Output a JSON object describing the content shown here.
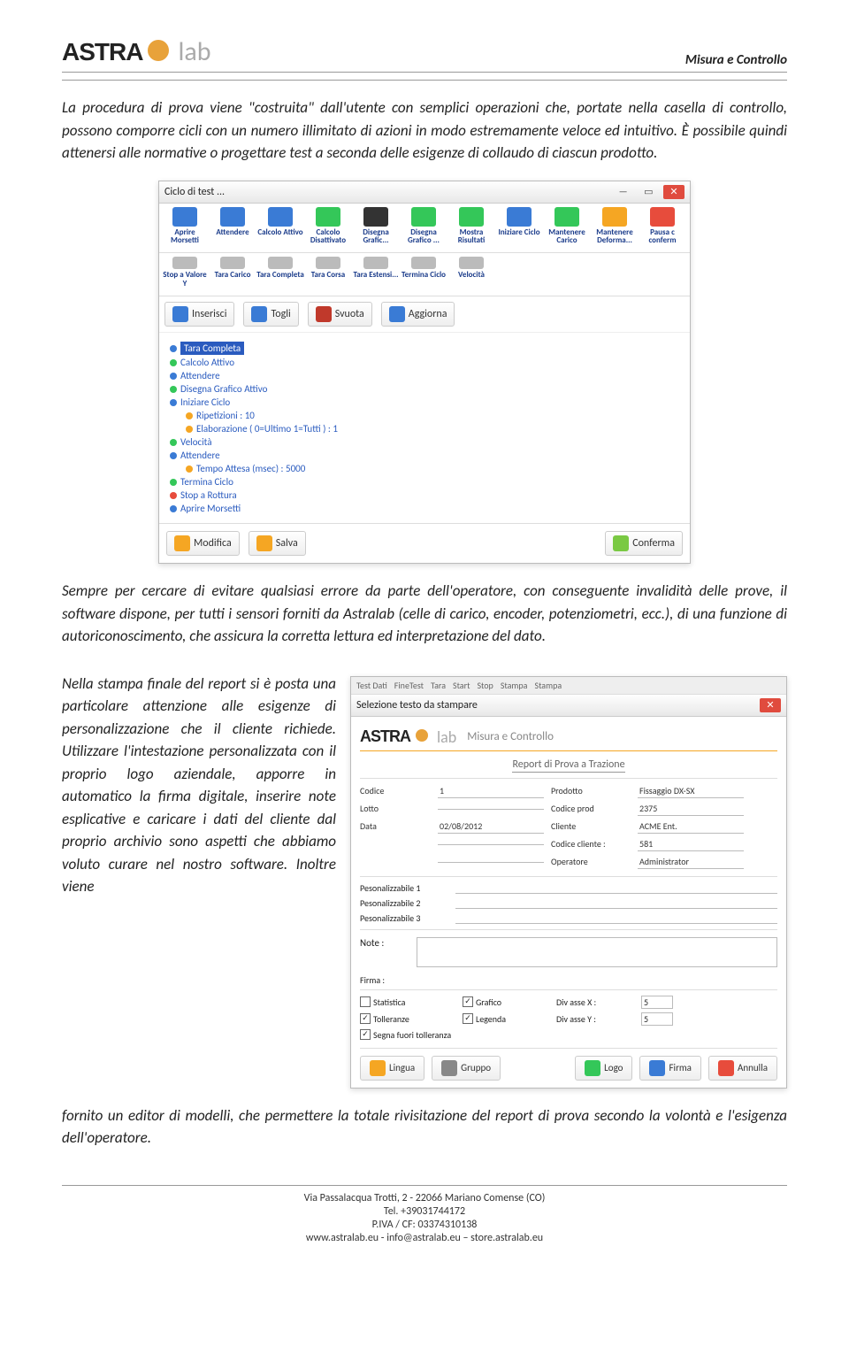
{
  "header": {
    "logo_main": "ASTRA",
    "logo_lab": "lab",
    "right_text": "Misura e Controllo"
  },
  "paragraphs": {
    "p1": "La procedura di prova viene \"costruita\" dall'utente con semplici operazioni che, portate nella casella di controllo, possono comporre cicli con un numero illimitato di azioni in modo estremamente veloce ed intuitivo. È possibile quindi attenersi alle normative o progettare test a seconda delle esigenze di collaudo di ciascun prodotto.",
    "p2": "Sempre per cercare di evitare qualsiasi errore da parte dell'operatore, con conseguente invalidità delle prove, il software dispone, per tutti i sensori forniti da Astralab (celle di carico, encoder, potenziometri, ecc.), di una funzione di autoriconoscimento, che assicura la corretta lettura ed interpretazione del dato.",
    "p3a": "Nella stampa finale del report si è posta una particolare attenzione alle esigenze di personalizzazione che il cliente richiede. Utilizzare l'intestazione personalizzata con il proprio logo aziendale, apporre in automatico la firma digitale, inserire note esplicative e caricare i dati del cliente dal proprio archivio sono aspetti che abbiamo voluto curare nel nostro software. Inoltre viene",
    "p3b": "fornito un editor di modelli, che permettere la totale rivisitazione del report di prova secondo la volontà e l'esigenza dell'operatore."
  },
  "ss1": {
    "title": "Ciclo di test ...",
    "toolbar": [
      {
        "label": "Aprire Morsetti",
        "c": "ic-blue"
      },
      {
        "label": "Attendere",
        "c": "ic-blue"
      },
      {
        "label": "Calcolo Attivo",
        "c": "ic-blue"
      },
      {
        "label": "Calcolo Disattivato",
        "c": "ic-green"
      },
      {
        "label": "Disegna Grafic...",
        "c": "ic-black"
      },
      {
        "label": "Disegna Grafico ...",
        "c": "ic-green"
      },
      {
        "label": "Mostra Risultati",
        "c": "ic-green"
      },
      {
        "label": "Iniziare Ciclo",
        "c": "ic-blue"
      },
      {
        "label": "Mantenere Carico",
        "c": "ic-green"
      },
      {
        "label": "Mantenere Deforma...",
        "c": "ic-orange"
      },
      {
        "label": "Pausa c conferm",
        "c": "ic-red"
      }
    ],
    "toolbar2": [
      {
        "label": "Stop a Valore Y"
      },
      {
        "label": "Tara Carico"
      },
      {
        "label": "Tara Completa"
      },
      {
        "label": "Tara Corsa"
      },
      {
        "label": "Tara Estensi...",
        "c": "ic-gray"
      },
      {
        "label": "Termina Ciclo"
      },
      {
        "label": "Velocità"
      }
    ],
    "row2": [
      {
        "label": "Inserisci",
        "c": "#3a7bd5"
      },
      {
        "label": "Togli",
        "c": "#3a7bd5"
      },
      {
        "label": "Svuota",
        "c": "#c0392b"
      },
      {
        "label": "Aggiorna",
        "c": "#3a7bd5"
      }
    ],
    "tree": [
      {
        "t": "Tara Completa",
        "sel": true,
        "d": "d-blue"
      },
      {
        "t": "Calcolo Attivo",
        "d": "d-green"
      },
      {
        "t": "Attendere",
        "d": "d-blue"
      },
      {
        "t": "Disegna Grafico Attivo",
        "d": "d-green"
      },
      {
        "t": "Iniziare Ciclo",
        "d": "d-blue"
      },
      {
        "t": "Ripetizioni : 10",
        "indent": 1,
        "d": "d-orange"
      },
      {
        "t": "Elaborazione ( 0=Ultimo 1=Tutti ) : 1",
        "indent": 1,
        "d": "d-orange"
      },
      {
        "t": "Velocità",
        "d": "d-green"
      },
      {
        "t": "Attendere",
        "d": "d-blue"
      },
      {
        "t": "Tempo Attesa (msec) : 5000",
        "indent": 1,
        "d": "d-orange"
      },
      {
        "t": "Termina Ciclo",
        "d": "d-green"
      },
      {
        "t": "Stop a Rottura",
        "d": "d-red"
      },
      {
        "t": "Aprire Morsetti",
        "d": "d-blue"
      }
    ],
    "row3": [
      {
        "label": "Modifica",
        "c": "#f5a623"
      },
      {
        "label": "Salva",
        "c": "#f5a623"
      },
      {
        "label": "Conferma",
        "c": "#7ac943"
      }
    ]
  },
  "ss2": {
    "menubar": [
      "Test Dati",
      "FineTest",
      "Tara",
      "Start",
      "Stop",
      "Stampa",
      "Stampa"
    ],
    "dlg_title": "Selezione testo da stampare",
    "header_text": "Misura e Controllo",
    "report_title": "Report di Prova a Trazione",
    "left": [
      {
        "l": "Codice",
        "v": "1"
      },
      {
        "l": "Lotto",
        "v": ""
      },
      {
        "l": "Data",
        "v": "02/08/2012"
      }
    ],
    "right": [
      {
        "l": "Prodotto",
        "v": "Fissaggio DX-SX"
      },
      {
        "l": "Codice prod",
        "v": "2375"
      },
      {
        "l": "Cliente",
        "v": "ACME Ent."
      },
      {
        "l": "Codice cliente :",
        "v": "581"
      },
      {
        "l": "Operatore",
        "v": "Administrator"
      }
    ],
    "pers": [
      "Pesonalizzabile 1",
      "Pesonalizzabile 2",
      "Pesonalizzabile 3"
    ],
    "note_label": "Note :",
    "firma_label": "Firma :",
    "checks_left": [
      {
        "l": "Statistica",
        "c": false
      },
      {
        "l": "Tolleranze",
        "c": true
      },
      {
        "l": "Segna fuori tolleranza",
        "c": true
      }
    ],
    "checks_mid": [
      {
        "l": "Grafico",
        "c": true
      },
      {
        "l": "Legenda",
        "c": true
      }
    ],
    "div_x": {
      "l": "Div asse X :",
      "v": "5"
    },
    "div_y": {
      "l": "Div asse Y :",
      "v": "5"
    },
    "buttons": [
      {
        "l": "Lingua",
        "c": "#f5a623"
      },
      {
        "l": "Gruppo",
        "c": "#888"
      },
      {
        "l": "Logo",
        "c": "#34c759"
      },
      {
        "l": "Firma",
        "c": "#3a7bd5"
      },
      {
        "l": "Annulla",
        "c": "#e74c3c"
      }
    ]
  },
  "footer": {
    "l1": "Via Passalacqua Trotti, 2 - 22066 Mariano Comense (CO)",
    "l2": "Tel. +39031744172",
    "l3": "P.IVA / CF: 03374310138",
    "l4": "www.astralab.eu -  info@astralab.eu – store.astralab.eu"
  }
}
